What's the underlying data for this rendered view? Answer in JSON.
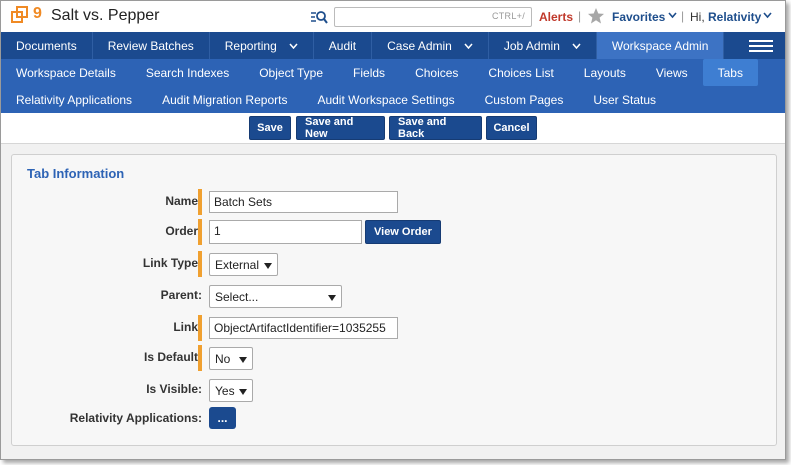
{
  "header": {
    "workspace_number": "9",
    "workspace_name": "Salt vs. Pepper",
    "search_hint": "CTRL+/",
    "alerts_label": "Alerts",
    "separator": "|",
    "favorites_label": "Favorites",
    "greeting": "Hi, ",
    "username": "Relativity"
  },
  "main_nav": {
    "items": [
      {
        "label": "Documents"
      },
      {
        "label": "Review Batches"
      },
      {
        "label": "Reporting"
      },
      {
        "label": "Audit"
      },
      {
        "label": "Case Admin"
      },
      {
        "label": "Job Admin"
      },
      {
        "label": "Workspace Admin"
      }
    ],
    "active": "Workspace Admin"
  },
  "sub_nav": {
    "row1": [
      {
        "label": "Workspace Details"
      },
      {
        "label": "Search Indexes"
      },
      {
        "label": "Object Type"
      },
      {
        "label": "Fields"
      },
      {
        "label": "Choices"
      },
      {
        "label": "Choices List"
      },
      {
        "label": "Layouts"
      },
      {
        "label": "Views"
      },
      {
        "label": "Tabs"
      }
    ],
    "row2": [
      {
        "label": "Relativity Applications"
      },
      {
        "label": "Audit Migration Reports"
      },
      {
        "label": "Audit Workspace Settings"
      },
      {
        "label": "Custom Pages"
      },
      {
        "label": "User Status"
      }
    ],
    "active": "Tabs"
  },
  "toolbar": {
    "save": "Save",
    "save_and_new": "Save and New",
    "save_and_back": "Save and Back",
    "cancel": "Cancel"
  },
  "form": {
    "section_title": "Tab Information",
    "name": {
      "label": "Name:",
      "value": "Batch Sets"
    },
    "order": {
      "label": "Order:",
      "value": "1",
      "button": "View Order"
    },
    "link_type": {
      "label": "Link Type:",
      "value": "External"
    },
    "parent": {
      "label": "Parent:",
      "value": "Select..."
    },
    "link": {
      "label": "Link:",
      "value": "ObjectArtifactIdentifier=1035255"
    },
    "is_default": {
      "label": "Is Default:",
      "value": "No"
    },
    "is_visible": {
      "label": "Is Visible:",
      "value": "Yes"
    },
    "relativity_applications": {
      "label": "Relativity Applications:",
      "button": "..."
    }
  },
  "colors": {
    "nav_dark": "#1b4a8f",
    "nav_mid": "#2d63b5",
    "alert_red": "#c0392b",
    "required_marker": "#f0a030",
    "logo_orange": "#f08a24"
  },
  "icons": [
    "workspace-logo-icon",
    "search-icon",
    "star-icon",
    "chevron-down-icon",
    "hamburger-menu-icon",
    "select-arrow-icon"
  ]
}
